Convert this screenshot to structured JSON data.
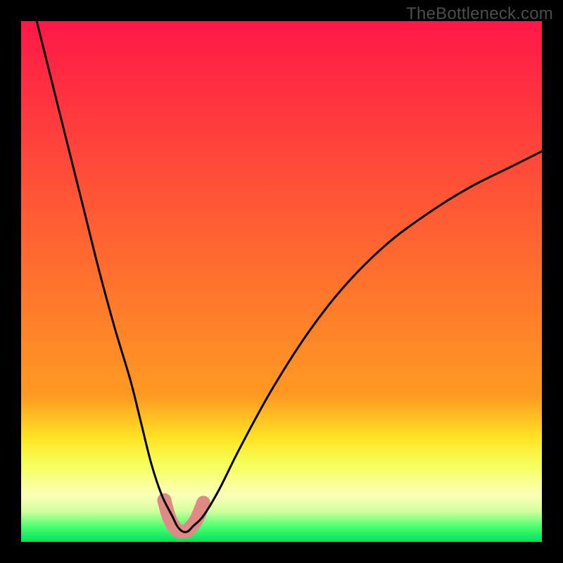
{
  "watermark": "TheBottleneck.com",
  "chart_data": {
    "type": "line",
    "title": "",
    "xlabel": "",
    "ylabel": "",
    "xlim": [
      0,
      100
    ],
    "ylim": [
      0,
      100
    ],
    "series": [
      {
        "name": "bottleneck-curve",
        "x": [
          3,
          6,
          9,
          12,
          15,
          18,
          21,
          23,
          25,
          27,
          29,
          30,
          31,
          32,
          33,
          35,
          38,
          42,
          48,
          55,
          62,
          70,
          78,
          86,
          94,
          100
        ],
        "values": [
          100,
          88,
          76,
          64,
          52,
          41,
          31,
          23,
          15,
          9,
          5,
          3,
          2,
          2,
          3,
          5,
          10,
          18,
          29,
          40,
          49,
          57,
          63,
          68,
          72,
          75
        ]
      },
      {
        "name": "highlight-marker",
        "x": [
          27.5,
          28.0,
          28.5,
          29.0,
          29.5,
          30.0,
          30.5,
          31.0,
          31.5,
          32.0,
          32.5,
          33.0,
          33.5,
          34.0,
          34.5,
          35.0
        ],
        "values": [
          8.0,
          6.0,
          4.5,
          3.5,
          2.8,
          2.3,
          2.0,
          2.0,
          2.0,
          2.2,
          2.7,
          3.3,
          4.0,
          5.0,
          6.2,
          7.5
        ]
      }
    ],
    "background_gradient_bands": [
      {
        "start": 100,
        "end": 28,
        "from": "#ff1847",
        "to": "#ff9a22"
      },
      {
        "start": 28,
        "end": 20,
        "from": "#ff9a22",
        "to": "#ffe324"
      },
      {
        "start": 20,
        "end": 15,
        "from": "#ffe324",
        "to": "#f6ff58"
      },
      {
        "start": 15,
        "end": 9,
        "from": "#f6ff58",
        "to": "#fbffb8"
      },
      {
        "start": 9,
        "end": 6,
        "from": "#fbffb8",
        "to": "#d4ff9e"
      },
      {
        "start": 6,
        "end": 3,
        "from": "#d4ff9e",
        "to": "#4dff71"
      },
      {
        "start": 3,
        "end": 0,
        "from": "#4dff71",
        "to": "#00e05b"
      }
    ],
    "colors": {
      "curve": "#000000",
      "highlight": "#e08a85",
      "frame": "#000000"
    }
  }
}
